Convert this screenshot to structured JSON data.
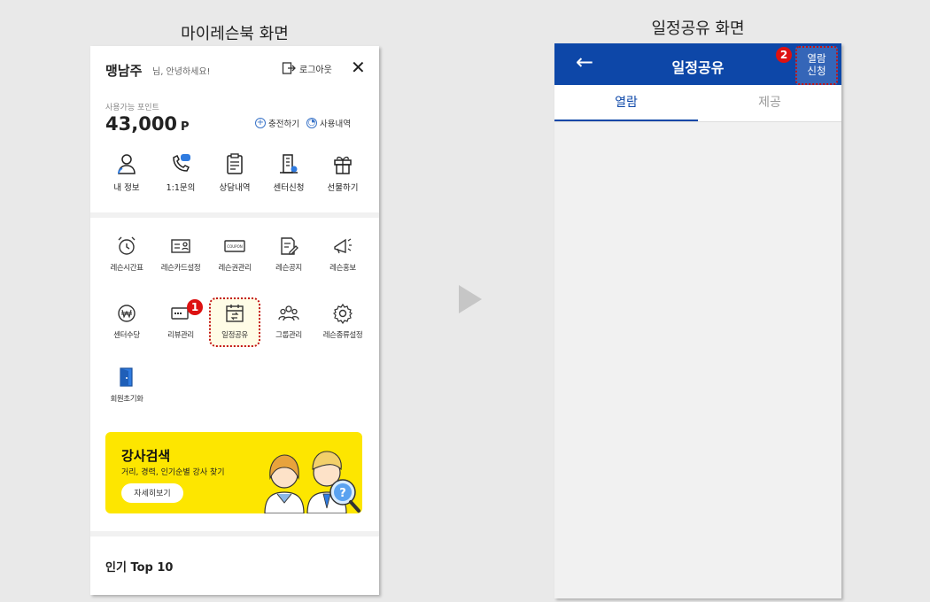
{
  "captions": {
    "left": "마이레슨북 화면",
    "right": "일정공유 화면"
  },
  "left_screen": {
    "user_name": "맹남주",
    "greeting": "님, 안녕하세요!",
    "logout_label": "로그아웃",
    "points": {
      "label": "사용가능 포인트",
      "value": "43,000",
      "unit": "P",
      "charge_label": "충전하기",
      "history_label": "사용내역"
    },
    "quick_menu": [
      {
        "label": "내 정보",
        "icon": "person-icon"
      },
      {
        "label": "1:1문의",
        "icon": "phone-chat-icon"
      },
      {
        "label": "상담내역",
        "icon": "clipboard-icon"
      },
      {
        "label": "센터신청",
        "icon": "building-icon"
      },
      {
        "label": "선물하기",
        "icon": "gift-icon"
      }
    ],
    "grid_row1": [
      {
        "label": "레슨시간표",
        "icon": "alarm-clock-icon"
      },
      {
        "label": "레슨카드설정",
        "icon": "id-card-icon"
      },
      {
        "label": "레슨권관리",
        "icon": "coupon-icon"
      },
      {
        "label": "레슨공지",
        "icon": "edit-note-icon"
      },
      {
        "label": "레슨홍보",
        "icon": "megaphone-icon"
      }
    ],
    "grid_row2": [
      {
        "label": "센터수당",
        "icon": "won-coin-icon"
      },
      {
        "label": "리뷰관리",
        "icon": "review-icon"
      },
      {
        "label": "일정공유",
        "icon": "calendar-share-icon"
      },
      {
        "label": "그룹관리",
        "icon": "group-icon"
      },
      {
        "label": "레슨종류설정",
        "icon": "gear-icon"
      }
    ],
    "grid_row3": [
      {
        "label": "회원초기화",
        "icon": "door-icon"
      }
    ],
    "coupon_text": "COUPON",
    "step1": "1",
    "banner": {
      "title": "강사검색",
      "subtitle": "거리, 경력, 인기순별 강사 찾기",
      "button": "자세히보기",
      "question_mark": "?"
    },
    "popular_title": "인기 Top 10",
    "colors": {
      "banner": "#fde600",
      "highlight_border": "#c21212"
    }
  },
  "right_screen": {
    "title": "일정공유",
    "request_button": [
      "열람",
      "신청"
    ],
    "step2": "2",
    "tabs": [
      {
        "label": "열람",
        "active": true
      },
      {
        "label": "제공",
        "active": false
      }
    ],
    "colors": {
      "header": "#0d47a8",
      "active_tab": "#0d47a8"
    }
  }
}
